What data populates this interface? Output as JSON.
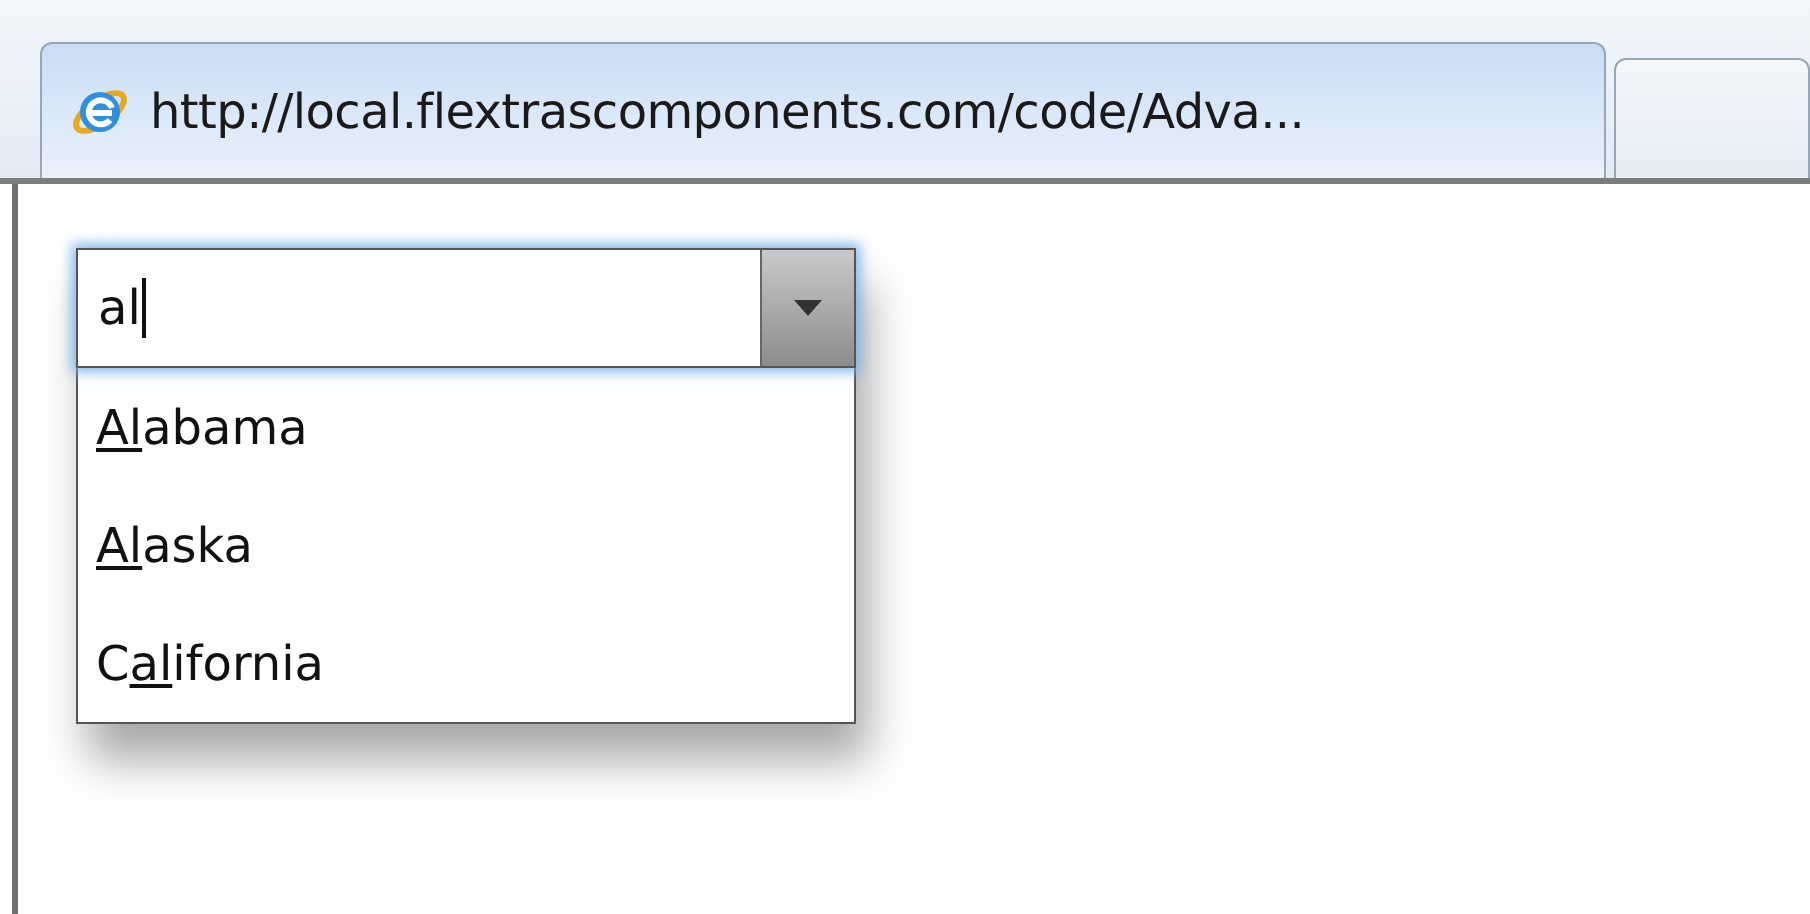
{
  "tabs": [
    {
      "label": "http://local.flextrascomponents.com/code/Adva...",
      "selected": true
    },
    {
      "selected": false
    }
  ],
  "combo": {
    "value": "al",
    "focused": true
  },
  "options": [
    {
      "match": "Al",
      "after": "abama"
    },
    {
      "match": "Al",
      "after": "aska"
    },
    {
      "before": "C",
      "match": "al",
      "after": "ifornia"
    }
  ]
}
